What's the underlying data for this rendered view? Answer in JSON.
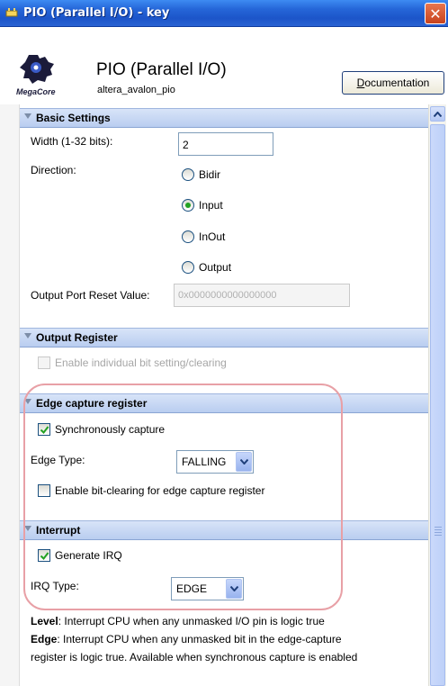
{
  "window": {
    "title": "PIO (Parallel I/O) - key",
    "close_glyph": "✕"
  },
  "header": {
    "logo_text": "MegaCore",
    "component_title": "PIO (Parallel I/O)",
    "component_name": "altera_avalon_pio",
    "doc_button_accel": "D",
    "doc_button_rest": "ocumentation"
  },
  "basic": {
    "header": "Basic Settings",
    "width_label": "Width (1-32 bits):",
    "width_value": "2",
    "direction_label": "Direction:",
    "options": [
      {
        "label": "Bidir",
        "selected": false
      },
      {
        "label": "Input",
        "selected": true
      },
      {
        "label": "InOut",
        "selected": false
      },
      {
        "label": "Output",
        "selected": false
      }
    ],
    "reset_label": "Output Port Reset Value:",
    "reset_value": "0x0000000000000000"
  },
  "output_register": {
    "header": "Output Register",
    "enable_bit_label": "Enable individual bit setting/clearing",
    "enable_bit_checked": false,
    "enable_bit_disabled": true
  },
  "edge_capture": {
    "header": "Edge capture register",
    "sync_label": "Synchronously capture",
    "sync_checked": true,
    "edge_type_label": "Edge Type:",
    "edge_type_value": "FALLING",
    "bitclear_label": "Enable bit-clearing for edge capture register",
    "bitclear_checked": false
  },
  "interrupt": {
    "header": "Interrupt",
    "irq_label": "Generate IRQ",
    "irq_checked": true,
    "irq_type_label": "IRQ Type:",
    "irq_type_value": "EDGE"
  },
  "description": {
    "level_term": "Level",
    "level_text": ": Interrupt CPU when any unmasked I/O pin is logic true",
    "edge_term": "Edge",
    "edge_text": ": Interrupt CPU when any unmasked bit in the edge-capture",
    "edge_text_2": "register is logic true. Available when synchronous capture is enabled"
  },
  "colors": {
    "titlebar": "#2566d8",
    "section_header": "#c4d5f3",
    "highlight_oval": "#e8a0a6",
    "radio_dot": "#21a121",
    "check_mark": "#21a121"
  }
}
